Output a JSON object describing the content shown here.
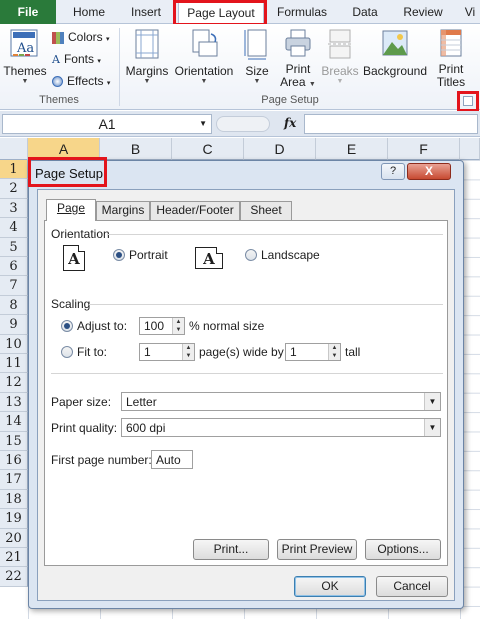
{
  "ribbon_tabs": [
    "File",
    "Home",
    "Insert",
    "Page Layout",
    "Formulas",
    "Data",
    "Review",
    "Vi"
  ],
  "active_tab": "Page Layout",
  "themes_group": {
    "themes_label": "Themes",
    "colors_label": "Colors",
    "fonts_label": "Fonts",
    "effects_label": "Effects",
    "group_label": "Themes"
  },
  "page_setup_group": {
    "margins_label": "Margins",
    "orientation_label": "Orientation",
    "size_label": "Size",
    "print_area_line1": "Print",
    "print_area_line2": "Area",
    "breaks_label": "Breaks",
    "background_label": "Background",
    "print_titles_line1": "Print",
    "print_titles_line2": "Titles",
    "group_label": "Page Setup"
  },
  "formula_bar": {
    "name_box": "A1",
    "fx": "fx"
  },
  "columns": [
    "A",
    "B",
    "C",
    "D",
    "E",
    "F"
  ],
  "selected_column": "A",
  "rows": [
    "1",
    "2",
    "3",
    "4",
    "5",
    "6",
    "7",
    "8",
    "9",
    "10",
    "11",
    "12",
    "13",
    "14",
    "15",
    "16",
    "17",
    "18",
    "19",
    "20",
    "21",
    "22"
  ],
  "selected_row": "1",
  "dialog": {
    "title": "Page Setup",
    "help": "?",
    "close": "X",
    "tabs": [
      "Page",
      "Margins",
      "Header/Footer",
      "Sheet"
    ],
    "active_tab": "Page",
    "orientation": {
      "section_label": "Orientation",
      "portrait_label": "Portrait",
      "landscape_label": "Landscape",
      "icon_glyph": "A",
      "selected": "Portrait"
    },
    "scaling": {
      "section_label": "Scaling",
      "adjust_to_label": "Adjust to:",
      "adjust_to_value": "100",
      "adjust_to_suffix": "% normal size",
      "fit_to_label": "Fit to:",
      "fit_wide_value": "1",
      "fit_wide_suffix": "page(s) wide by",
      "fit_tall_value": "1",
      "fit_tall_suffix": "tall",
      "selected": "Adjust to"
    },
    "paper_size_label": "Paper size:",
    "paper_size_value": "Letter",
    "print_quality_label": "Print quality:",
    "print_quality_value": "600 dpi",
    "first_page_label": "First page number:",
    "first_page_value": "Auto",
    "print_button": "Print...",
    "print_preview_button": "Print Preview",
    "options_button": "Options...",
    "ok_button": "OK",
    "cancel_button": "Cancel"
  },
  "highlight_color": "#e3141c",
  "file_tab_color": "#2a7a3a"
}
